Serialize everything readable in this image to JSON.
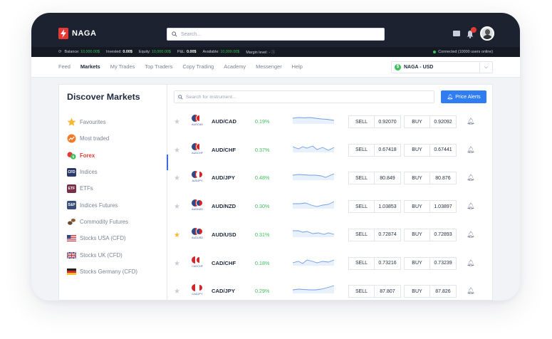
{
  "header": {
    "logo_text": "NAGA",
    "search_placeholder": "Search...",
    "notification_count": "4"
  },
  "status": {
    "balance_label": "Balance:",
    "balance_value": "10,000.00$",
    "invested_label": "Invested:",
    "invested_value": "0.00$",
    "equity_label": "Equity:",
    "equity_value": "10,000.00$",
    "pnl_label": "P&L:",
    "pnl_value": "0.00$",
    "available_label": "Available:",
    "available_value": "10,000.00$",
    "margin_label": "Margin level: -",
    "connected_text": "Connected (10000 users online)"
  },
  "nav": {
    "tabs": [
      "Feed",
      "Markets",
      "My Trades",
      "Top Traders",
      "Copy Trading",
      "Academy",
      "Messenger",
      "Help"
    ],
    "active_tab": "Markets",
    "account_label": "NAGA - USD",
    "account_badge": "$"
  },
  "sidebar": {
    "title": "Discover Markets",
    "items": [
      {
        "label": "Favourites",
        "icon": "star-icon"
      },
      {
        "label": "Most traded",
        "icon": "trend-icon"
      },
      {
        "label": "Forex",
        "icon": "forex-icon"
      },
      {
        "label": "Indices",
        "icon": "cfd-icon",
        "icon_text": "CFD"
      },
      {
        "label": "ETFs",
        "icon": "etf-icon",
        "icon_text": "ETF"
      },
      {
        "label": "Indices Futures",
        "icon": "sp-icon",
        "icon_text": "S&P"
      },
      {
        "label": "Commodity Futures",
        "icon": "coffee-icon"
      },
      {
        "label": "Stocks USA (CFD)",
        "icon": "us-flag-icon"
      },
      {
        "label": "Stocks UK (CFD)",
        "icon": "uk-flag-icon"
      },
      {
        "label": "Stocks Germany (CFD)",
        "icon": "de-flag-icon"
      }
    ],
    "active_item": "Forex"
  },
  "main": {
    "search_placeholder": "Search for instrument...",
    "alerts_button": "Price Alerts",
    "sell_label": "SELL",
    "buy_label": "BUY",
    "instruments": [
      {
        "symbol": "AUD/CAD",
        "code": "AUDCAD",
        "change": "0.19%",
        "sell": "0.92070",
        "buy": "0.92092",
        "favourite": false
      },
      {
        "symbol": "AUD/CHF",
        "code": "AUDCHF",
        "change": "0.37%",
        "sell": "0.67418",
        "buy": "0.67441",
        "favourite": false
      },
      {
        "symbol": "AUD/JPY",
        "code": "AUDJPY",
        "change": "0.48%",
        "sell": "80.849",
        "buy": "80.876",
        "favourite": false
      },
      {
        "symbol": "AUD/NZD",
        "code": "AUDNZD",
        "change": "0.30%",
        "sell": "1.03853",
        "buy": "1.03897",
        "favourite": false
      },
      {
        "symbol": "AUD/USD",
        "code": "AUDUSD",
        "change": "0.31%",
        "sell": "0.72874",
        "buy": "0.72893",
        "favourite": true
      },
      {
        "symbol": "CAD/CHF",
        "code": "CADCHF",
        "change": "0.18%",
        "sell": "0.73216",
        "buy": "0.73239",
        "favourite": false
      },
      {
        "symbol": "CAD/JPY",
        "code": "CADJPY",
        "change": "0.29%",
        "sell": "87.807",
        "buy": "87.826",
        "favourite": false
      }
    ]
  },
  "colors": {
    "brand_red": "#e53935",
    "positive_green": "#3dbf5a",
    "accent_blue": "#2f7df0",
    "header_dark": "#1c2230"
  }
}
